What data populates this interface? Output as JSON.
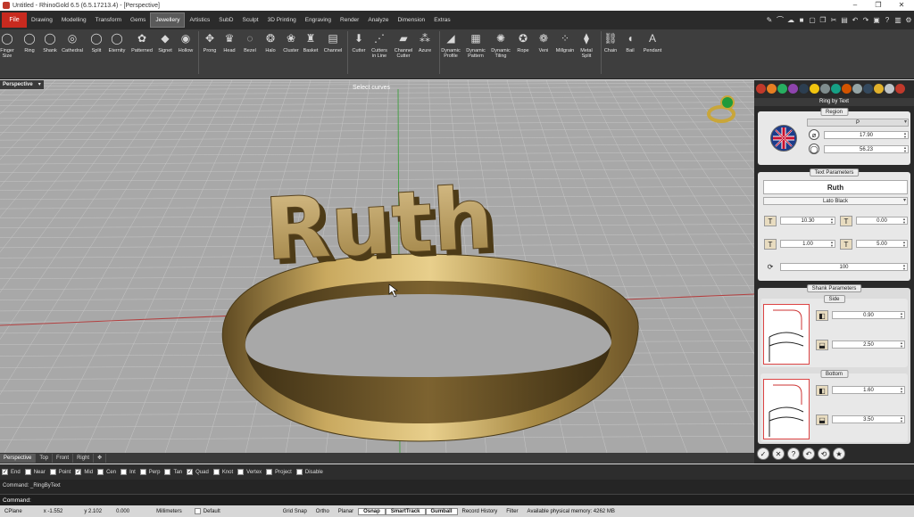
{
  "window": {
    "title": "Untitled - RhinoGold 6.5 (6.5.17213.4) - [Perspective]",
    "minimize": "–",
    "maximize": "❐",
    "close": "✕"
  },
  "menu": {
    "file": "File",
    "tabs": [
      "Drawing",
      "Modelling",
      "Transform",
      "Gems",
      "Jewellery",
      "Artistics",
      "SubD",
      "Sculpt",
      "3D Printing",
      "Engraving",
      "Render",
      "Analyze",
      "Dimension",
      "Extras"
    ],
    "active_tab": "Jewellery"
  },
  "ribbon": {
    "tools": [
      {
        "label": "Finger\nSize",
        "icon": "ring-size-icon",
        "glyph": "◯"
      },
      {
        "label": "Ring",
        "icon": "ring-icon",
        "glyph": "◯"
      },
      {
        "label": "Shank",
        "icon": "shank-icon",
        "glyph": "◯"
      },
      {
        "label": "Cathedral",
        "icon": "cathedral-icon",
        "glyph": "◎"
      },
      {
        "label": "Split",
        "icon": "split-icon",
        "glyph": "◯"
      },
      {
        "label": "Eternity",
        "icon": "eternity-icon",
        "glyph": "◯"
      },
      {
        "label": "Patterned",
        "icon": "patterned-icon",
        "glyph": "✿"
      },
      {
        "label": "Signet",
        "icon": "signet-icon",
        "glyph": "◆"
      },
      {
        "label": "Hollow",
        "icon": "hollow-icon",
        "glyph": "◉"
      },
      {
        "label": "Prong",
        "icon": "prong-icon",
        "glyph": "✥"
      },
      {
        "label": "Head",
        "icon": "head-icon",
        "glyph": "♛"
      },
      {
        "label": "Bezel",
        "icon": "bezel-icon",
        "glyph": "◌"
      },
      {
        "label": "Halo",
        "icon": "halo-icon",
        "glyph": "❂"
      },
      {
        "label": "Cluster",
        "icon": "cluster-icon",
        "glyph": "❀"
      },
      {
        "label": "Basket",
        "icon": "basket-icon",
        "glyph": "♜"
      },
      {
        "label": "Channel",
        "icon": "channel-icon",
        "glyph": "▤"
      },
      {
        "label": "Cutter",
        "icon": "cutter-icon",
        "glyph": "⬇"
      },
      {
        "label": "Cutters\nin Line",
        "icon": "cutters-line-icon",
        "glyph": "⋰"
      },
      {
        "label": "Channel\nCutter",
        "icon": "channel-cutter-icon",
        "glyph": "▰"
      },
      {
        "label": "Azure",
        "icon": "azure-icon",
        "glyph": "⁂"
      },
      {
        "label": "Dynamic\nProfile",
        "icon": "dynamic-profile-icon",
        "glyph": "◢"
      },
      {
        "label": "Dynamic\nPattern",
        "icon": "dynamic-pattern-icon",
        "glyph": "▦"
      },
      {
        "label": "Dynamic\nTiling",
        "icon": "dynamic-tiling-icon",
        "glyph": "✺"
      },
      {
        "label": "Rope",
        "icon": "rope-icon",
        "glyph": "✪"
      },
      {
        "label": "Veni",
        "icon": "veni-icon",
        "glyph": "❁"
      },
      {
        "label": "Millgrain",
        "icon": "millgrain-icon",
        "glyph": "⁘"
      },
      {
        "label": "Metal\nSplit",
        "icon": "metal-split-icon",
        "glyph": "⧫"
      },
      {
        "label": "Chain",
        "icon": "chain-icon",
        "glyph": "⛓"
      },
      {
        "label": "Bail",
        "icon": "bail-icon",
        "glyph": "◖"
      },
      {
        "label": "Pendant",
        "icon": "pendant-icon",
        "glyph": "A"
      }
    ]
  },
  "viewport": {
    "name": "Perspective",
    "dropdown": "▾",
    "prompt": "Select curves",
    "model_text": "Ruth"
  },
  "panel": {
    "title": "Ring by Text",
    "region": {
      "legend": "Region",
      "value": "P",
      "diameter": "17.90",
      "circumference": "56.23"
    },
    "text_parameters": {
      "legend": "Text Parameters",
      "text": "Ruth",
      "font": "Lato Black",
      "size": "10.30",
      "spacing": "0.00",
      "scale": "1.00",
      "height": "5.00",
      "rotation": "100"
    },
    "shank": {
      "legend": "Shank Parameters",
      "side": {
        "legend": "Side",
        "width": "0.90",
        "thickness": "2.50"
      },
      "bottom": {
        "legend": "Bottom",
        "width": "1.60",
        "thickness": "3.50"
      }
    },
    "buttons": [
      "✓",
      "✕",
      "?",
      "↶",
      "⟲",
      "★"
    ]
  },
  "viewport_tabs": [
    "Perspective",
    "Top",
    "Front",
    "Right",
    "✥"
  ],
  "osnaps": [
    {
      "label": "End",
      "checked": true
    },
    {
      "label": "Near",
      "checked": false
    },
    {
      "label": "Point",
      "checked": false
    },
    {
      "label": "Mid",
      "checked": true
    },
    {
      "label": "Cen",
      "checked": false
    },
    {
      "label": "Int",
      "checked": false
    },
    {
      "label": "Perp",
      "checked": false
    },
    {
      "label": "Tan",
      "checked": false
    },
    {
      "label": "Quad",
      "checked": true
    },
    {
      "label": "Knot",
      "checked": false
    },
    {
      "label": "Vertex",
      "checked": false
    },
    {
      "label": "Project",
      "checked": false
    },
    {
      "label": "Disable",
      "checked": false
    }
  ],
  "command_history": "Command: _RingByText",
  "command_line": "Command:",
  "status": {
    "cplane": "CPlane",
    "x": "x -1.552",
    "y": "y 2.102",
    "z": "0.000",
    "units": "Millimeters",
    "layer": "Default",
    "toggles": [
      {
        "label": "Grid Snap",
        "on": false
      },
      {
        "label": "Ortho",
        "on": false
      },
      {
        "label": "Planar",
        "on": false
      },
      {
        "label": "Osnap",
        "on": true
      },
      {
        "label": "SmartTrack",
        "on": true
      },
      {
        "label": "Gumball",
        "on": true
      },
      {
        "label": "Record History",
        "on": false
      },
      {
        "label": "Filter",
        "on": false
      }
    ],
    "memory": "Available physical memory: 4262 MB"
  },
  "colors": {
    "gold": "#b89a55",
    "accent_red": "#c82a1f"
  }
}
